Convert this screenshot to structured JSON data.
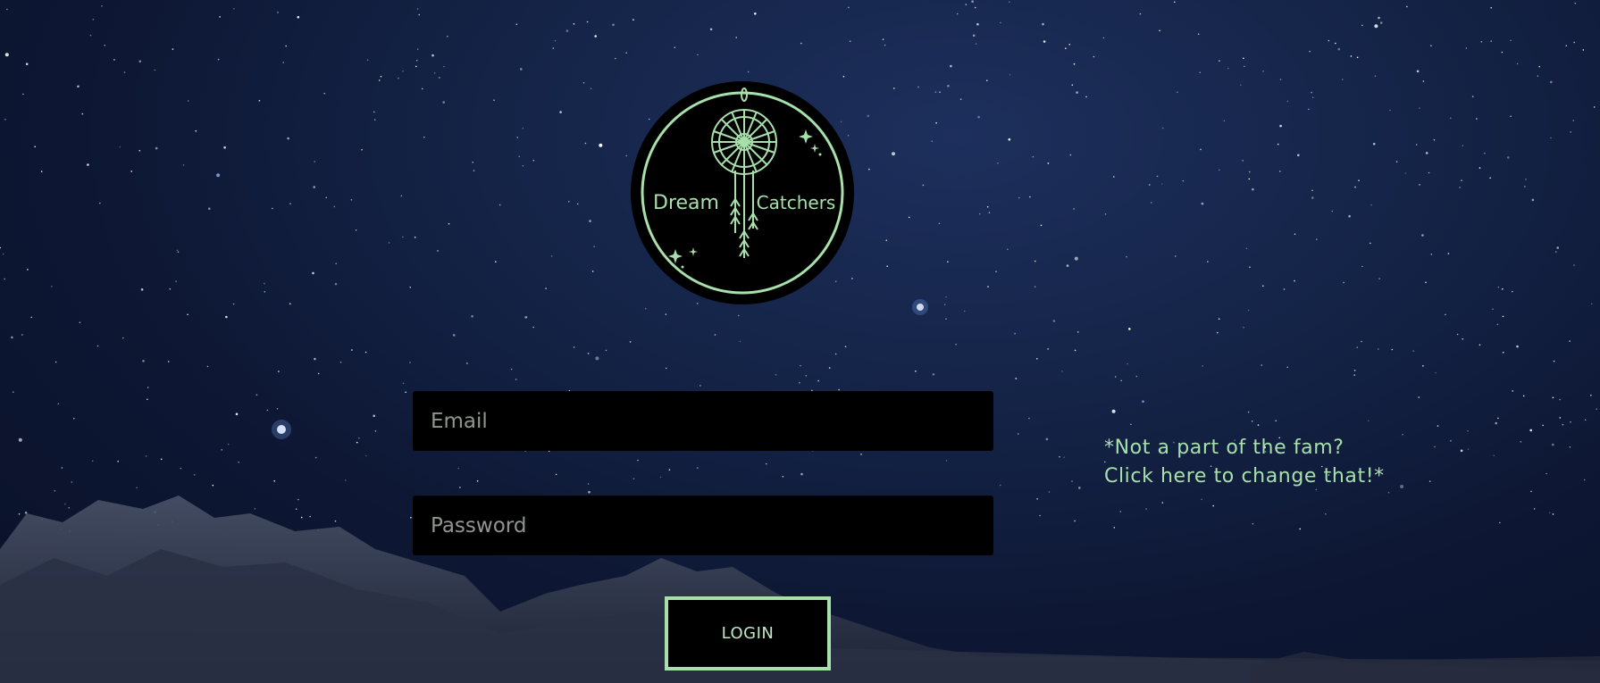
{
  "brand": {
    "logo_left_text": "Dream",
    "logo_right_text": "Catchers",
    "accent_color": "#a8e0ab"
  },
  "login_form": {
    "email_placeholder": "Email",
    "password_placeholder": "Password",
    "login_label": "LOGIN"
  },
  "signup": {
    "line1": "*Not a part of the fam?",
    "line2": "Click here to change that!*"
  },
  "icons": {
    "logo": "dreamcatcher-icon",
    "sparkles": "sparkle-icon"
  }
}
